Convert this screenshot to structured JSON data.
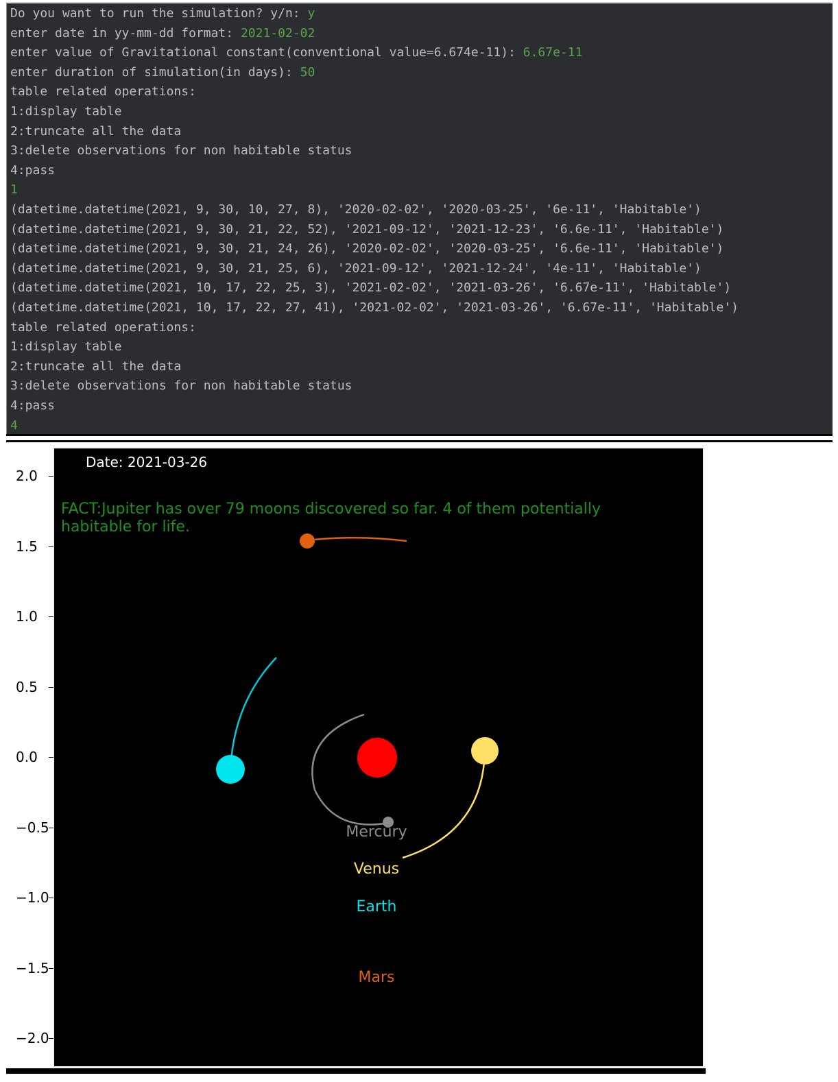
{
  "console": {
    "lines": [
      {
        "text": "Do you want to run the simulation? y/n: ",
        "input": "y"
      },
      {
        "text": "enter date in yy-mm-dd format: ",
        "input": "2021-02-02"
      },
      {
        "text": "enter value of Gravitational constant(conventional value=6.674e-11): ",
        "input": "6.67e-11"
      },
      {
        "text": "enter duration of simulation(in days): ",
        "input": "50"
      },
      {
        "text": "table related operations:",
        "input": ""
      },
      {
        "text": "1:display table",
        "input": ""
      },
      {
        "text": "2:truncate all the data",
        "input": ""
      },
      {
        "text": "3:delete observations for non habitable status",
        "input": ""
      },
      {
        "text": "4:pass",
        "input": ""
      },
      {
        "text": "",
        "input": "1"
      },
      {
        "text": "(datetime.datetime(2021, 9, 30, 10, 27, 8), '2020-02-02', '2020-03-25', '6e-11', 'Habitable')",
        "input": ""
      },
      {
        "text": "(datetime.datetime(2021, 9, 30, 21, 22, 52), '2021-09-12', '2021-12-23', '6.6e-11', 'Habitable')",
        "input": ""
      },
      {
        "text": "(datetime.datetime(2021, 9, 30, 21, 24, 26), '2020-02-02', '2020-03-25', '6.6e-11', 'Habitable')",
        "input": ""
      },
      {
        "text": "(datetime.datetime(2021, 9, 30, 21, 25, 6), '2021-09-12', '2021-12-24', '4e-11', 'Habitable')",
        "input": ""
      },
      {
        "text": "(datetime.datetime(2021, 10, 17, 22, 25, 3), '2021-02-02', '2021-03-26', '6.67e-11', 'Habitable')",
        "input": ""
      },
      {
        "text": "(datetime.datetime(2021, 10, 17, 22, 27, 41), '2021-02-02', '2021-03-26', '6.67e-11', 'Habitable')",
        "input": ""
      },
      {
        "text": "table related operations:",
        "input": ""
      },
      {
        "text": "1:display table",
        "input": ""
      },
      {
        "text": "2:truncate all the data",
        "input": ""
      },
      {
        "text": "3:delete observations for non habitable status",
        "input": ""
      },
      {
        "text": "4:pass",
        "input": ""
      },
      {
        "text": "",
        "input": "4"
      }
    ],
    "colors": {
      "background": "#2b2d30",
      "text": "#bcbec4",
      "input": "#5aa34a"
    }
  },
  "simulation": {
    "date_label": "Date: 2021-03-26",
    "fact_line1": "FACT:Jupiter has over 79 moons discovered so far. 4 of them potentially",
    "fact_line2": "habitable for life.",
    "y_ticks": [
      "2.0",
      "1.5",
      "1.0",
      "0.5",
      "0.0",
      "−0.5",
      "−1.0",
      "−1.5",
      "−2.0"
    ],
    "labels": {
      "mercury": "Mercury",
      "venus": "Venus",
      "earth": "Earth",
      "mars": "Mars"
    },
    "colors": {
      "sun": "#ff0000",
      "mercury": "#8c8c8c",
      "venus": "#ffe066",
      "earth": "#00e5ee",
      "mars": "#e06010",
      "fact": "#1f8f1f",
      "axes_background": "#000000"
    }
  }
}
